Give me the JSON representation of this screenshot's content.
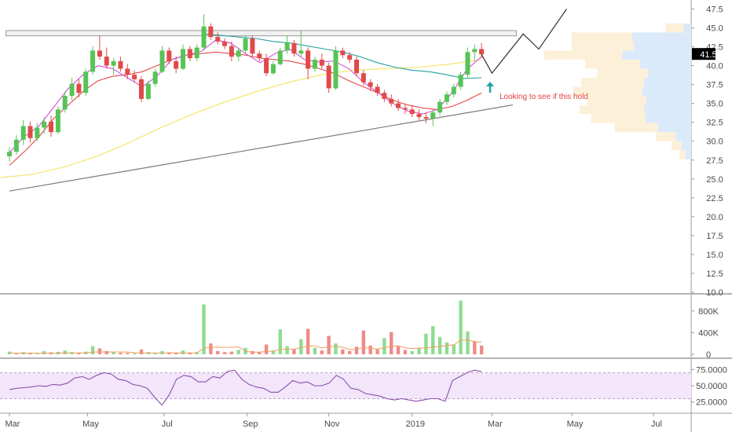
{
  "chart_data": {
    "type": "candlestick",
    "x_ticks": [
      "Mar",
      "May",
      "Jul",
      "Sep",
      "Nov",
      "2019",
      "Mar",
      "May",
      "Jul"
    ],
    "price_ticks": [
      "47.5",
      "45.0",
      "42.5",
      "40.0",
      "37.5",
      "35.0",
      "32.5",
      "30.0",
      "27.5",
      "25.0",
      "22.5",
      "20.0",
      "17.5",
      "15.0",
      "12.5",
      "10.0"
    ],
    "price_axis_range": [
      10.0,
      47.5
    ],
    "last_price_label": "41.5",
    "last_price_tag_color": "#e04a4a",
    "volume_ticks": [
      "800K",
      "400K",
      "0"
    ],
    "rsi_ticks": [
      "75.0000",
      "50.0000",
      "25.0000"
    ],
    "rsi_band": [
      30,
      70
    ],
    "annotation_text": "Looking to see if this hold",
    "colors": {
      "up": "#56c456",
      "down": "#e04a4a",
      "ma_fast": "#d84fd8",
      "ma_mid": "#e04a4a",
      "ma_teal": "#27a0a0",
      "ma_slow": "#f6e262",
      "trendline": "#7a7a7a",
      "resistance": "#9a9a9a",
      "arrow": "#27a0a0",
      "rsi_line": "#8b4fa8",
      "rsi_fill": "#f3e6fb",
      "vp_blue": "#dbeafb",
      "vp_orange": "#fdf0d9"
    },
    "resistance_level": 44.3,
    "price_series": [
      {
        "d": 0,
        "o": 28.0,
        "h": 29.2,
        "l": 27.3,
        "c": 28.6
      },
      {
        "d": 4,
        "o": 28.6,
        "h": 30.8,
        "l": 28.2,
        "c": 30.2
      },
      {
        "d": 8,
        "o": 30.2,
        "h": 32.8,
        "l": 29.5,
        "c": 32.0
      },
      {
        "d": 12,
        "o": 32.0,
        "h": 32.6,
        "l": 29.8,
        "c": 30.4
      },
      {
        "d": 16,
        "o": 30.4,
        "h": 32.4,
        "l": 30.0,
        "c": 31.8
      },
      {
        "d": 20,
        "o": 31.8,
        "h": 33.2,
        "l": 31.0,
        "c": 32.6
      },
      {
        "d": 24,
        "o": 32.6,
        "h": 33.4,
        "l": 30.6,
        "c": 31.2
      },
      {
        "d": 28,
        "o": 31.2,
        "h": 34.6,
        "l": 31.0,
        "c": 34.2
      },
      {
        "d": 32,
        "o": 34.2,
        "h": 36.6,
        "l": 33.8,
        "c": 36.0
      },
      {
        "d": 36,
        "o": 36.0,
        "h": 38.4,
        "l": 35.4,
        "c": 37.6
      },
      {
        "d": 40,
        "o": 37.6,
        "h": 38.2,
        "l": 35.8,
        "c": 36.4
      },
      {
        "d": 44,
        "o": 36.4,
        "h": 39.6,
        "l": 36.0,
        "c": 39.2
      },
      {
        "d": 48,
        "o": 39.2,
        "h": 42.6,
        "l": 38.8,
        "c": 42.0
      },
      {
        "d": 52,
        "o": 42.0,
        "h": 44.0,
        "l": 40.8,
        "c": 41.2
      },
      {
        "d": 56,
        "o": 41.2,
        "h": 42.4,
        "l": 39.6,
        "c": 40.0
      },
      {
        "d": 60,
        "o": 40.0,
        "h": 41.0,
        "l": 38.8,
        "c": 40.6
      },
      {
        "d": 64,
        "o": 40.6,
        "h": 41.2,
        "l": 39.2,
        "c": 39.6
      },
      {
        "d": 68,
        "o": 39.6,
        "h": 40.2,
        "l": 38.2,
        "c": 38.8
      },
      {
        "d": 72,
        "o": 38.8,
        "h": 39.4,
        "l": 37.8,
        "c": 38.2
      },
      {
        "d": 76,
        "o": 38.2,
        "h": 38.6,
        "l": 35.2,
        "c": 35.6
      },
      {
        "d": 80,
        "o": 35.6,
        "h": 38.0,
        "l": 35.4,
        "c": 37.6
      },
      {
        "d": 84,
        "o": 37.6,
        "h": 39.6,
        "l": 37.2,
        "c": 39.2
      },
      {
        "d": 88,
        "o": 39.2,
        "h": 42.6,
        "l": 39.0,
        "c": 42.0
      },
      {
        "d": 92,
        "o": 42.0,
        "h": 42.4,
        "l": 40.2,
        "c": 40.6
      },
      {
        "d": 96,
        "o": 40.6,
        "h": 41.2,
        "l": 39.0,
        "c": 39.6
      },
      {
        "d": 100,
        "o": 39.6,
        "h": 42.8,
        "l": 39.4,
        "c": 42.2
      },
      {
        "d": 104,
        "o": 42.2,
        "h": 42.6,
        "l": 40.6,
        "c": 41.0
      },
      {
        "d": 108,
        "o": 41.0,
        "h": 42.8,
        "l": 40.6,
        "c": 42.4
      },
      {
        "d": 112,
        "o": 42.4,
        "h": 46.8,
        "l": 42.0,
        "c": 45.2
      },
      {
        "d": 116,
        "o": 45.2,
        "h": 45.6,
        "l": 43.4,
        "c": 43.8
      },
      {
        "d": 120,
        "o": 43.8,
        "h": 44.4,
        "l": 42.8,
        "c": 43.2
      },
      {
        "d": 124,
        "o": 43.2,
        "h": 43.6,
        "l": 42.2,
        "c": 42.6
      },
      {
        "d": 128,
        "o": 42.6,
        "h": 43.2,
        "l": 40.6,
        "c": 41.2
      },
      {
        "d": 132,
        "o": 41.2,
        "h": 42.4,
        "l": 40.6,
        "c": 42.0
      },
      {
        "d": 136,
        "o": 42.0,
        "h": 44.0,
        "l": 41.6,
        "c": 43.6
      },
      {
        "d": 140,
        "o": 43.6,
        "h": 44.0,
        "l": 41.2,
        "c": 41.6
      },
      {
        "d": 144,
        "o": 41.6,
        "h": 42.0,
        "l": 40.6,
        "c": 41.0
      },
      {
        "d": 148,
        "o": 41.0,
        "h": 41.6,
        "l": 38.6,
        "c": 39.0
      },
      {
        "d": 152,
        "o": 39.0,
        "h": 40.6,
        "l": 38.8,
        "c": 40.2
      },
      {
        "d": 156,
        "o": 40.2,
        "h": 42.4,
        "l": 40.0,
        "c": 42.0
      },
      {
        "d": 160,
        "o": 42.0,
        "h": 44.0,
        "l": 41.6,
        "c": 43.0
      },
      {
        "d": 164,
        "o": 43.0,
        "h": 43.4,
        "l": 41.2,
        "c": 41.6
      },
      {
        "d": 168,
        "o": 41.6,
        "h": 44.6,
        "l": 41.2,
        "c": 42.0
      },
      {
        "d": 172,
        "o": 42.0,
        "h": 42.4,
        "l": 38.2,
        "c": 39.6
      },
      {
        "d": 176,
        "o": 39.6,
        "h": 41.2,
        "l": 39.2,
        "c": 40.8
      },
      {
        "d": 180,
        "o": 40.8,
        "h": 41.6,
        "l": 39.6,
        "c": 40.0
      },
      {
        "d": 184,
        "o": 40.0,
        "h": 40.4,
        "l": 36.4,
        "c": 37.0
      },
      {
        "d": 188,
        "o": 37.0,
        "h": 42.6,
        "l": 36.8,
        "c": 42.0
      },
      {
        "d": 192,
        "o": 42.0,
        "h": 42.4,
        "l": 41.0,
        "c": 41.4
      },
      {
        "d": 196,
        "o": 41.4,
        "h": 41.8,
        "l": 40.4,
        "c": 40.8
      },
      {
        "d": 200,
        "o": 40.8,
        "h": 41.2,
        "l": 38.6,
        "c": 39.0
      },
      {
        "d": 204,
        "o": 39.0,
        "h": 39.4,
        "l": 37.4,
        "c": 37.8
      },
      {
        "d": 208,
        "o": 37.8,
        "h": 38.2,
        "l": 36.6,
        "c": 37.2
      },
      {
        "d": 212,
        "o": 37.2,
        "h": 37.6,
        "l": 36.0,
        "c": 36.4
      },
      {
        "d": 216,
        "o": 36.4,
        "h": 36.8,
        "l": 35.2,
        "c": 35.6
      },
      {
        "d": 220,
        "o": 35.6,
        "h": 36.2,
        "l": 34.6,
        "c": 35.0
      },
      {
        "d": 224,
        "o": 35.0,
        "h": 35.6,
        "l": 34.0,
        "c": 34.4
      },
      {
        "d": 228,
        "o": 34.4,
        "h": 35.0,
        "l": 33.6,
        "c": 34.2
      },
      {
        "d": 232,
        "o": 34.2,
        "h": 34.8,
        "l": 33.2,
        "c": 33.6
      },
      {
        "d": 236,
        "o": 33.6,
        "h": 34.2,
        "l": 32.8,
        "c": 33.2
      },
      {
        "d": 240,
        "o": 33.2,
        "h": 33.8,
        "l": 32.4,
        "c": 33.0
      },
      {
        "d": 244,
        "o": 33.0,
        "h": 34.2,
        "l": 32.0,
        "c": 33.8
      },
      {
        "d": 248,
        "o": 33.8,
        "h": 35.6,
        "l": 33.4,
        "c": 35.2
      },
      {
        "d": 252,
        "o": 35.2,
        "h": 36.6,
        "l": 34.8,
        "c": 36.2
      },
      {
        "d": 256,
        "o": 36.2,
        "h": 37.6,
        "l": 35.8,
        "c": 37.2
      },
      {
        "d": 260,
        "o": 37.2,
        "h": 39.2,
        "l": 36.8,
        "c": 38.8
      },
      {
        "d": 264,
        "o": 38.8,
        "h": 42.4,
        "l": 38.4,
        "c": 41.8
      },
      {
        "d": 268,
        "o": 41.8,
        "h": 42.8,
        "l": 40.6,
        "c": 42.2
      },
      {
        "d": 272,
        "o": 42.2,
        "h": 43.0,
        "l": 41.0,
        "c": 41.5
      }
    ],
    "projection": [
      {
        "d": 272,
        "p": 41.5
      },
      {
        "d": 278,
        "p": 39.0
      },
      {
        "d": 296,
        "p": 44.2
      },
      {
        "d": 305,
        "p": 42.2
      },
      {
        "d": 321,
        "p": 47.5
      }
    ],
    "ma_fast": [
      28.5,
      30.6,
      32.0,
      34.5,
      37.0,
      38.8,
      40.0,
      39.6,
      38.4,
      37.2,
      38.6,
      40.8,
      41.4,
      41.9,
      43.4,
      43.0,
      41.6,
      40.4,
      41.6,
      42.2,
      40.8,
      40.5,
      40.6,
      39.6,
      37.8,
      36.4,
      35.0,
      34.0,
      33.6,
      34.2,
      36.4,
      39.5,
      41.2
    ],
    "ma_mid": [
      26.8,
      28.6,
      30.6,
      33.0,
      34.8,
      36.6,
      38.0,
      38.6,
      38.8,
      39.2,
      40.0,
      40.8,
      41.4,
      41.6,
      41.8,
      41.6,
      41.4,
      41.0,
      40.8,
      40.6,
      40.2,
      39.6,
      39.0,
      38.0,
      37.2,
      36.4,
      35.4,
      34.8,
      34.4,
      34.2,
      34.6,
      35.4,
      36.4
    ],
    "ma_teal": [
      44.2,
      44.0,
      43.8,
      43.6,
      43.2,
      43.0,
      42.6,
      42.2,
      41.8,
      41.2,
      40.4,
      39.8,
      39.4,
      39.2,
      38.8,
      38.3,
      38.4
    ],
    "ma_slow": [
      25.2,
      25.6,
      26.6,
      28.0,
      29.8,
      31.8,
      33.6,
      35.2,
      36.6,
      37.8,
      38.8,
      39.4,
      39.6,
      39.8,
      40.2,
      40.8
    ],
    "trendline": [
      {
        "d": 0,
        "p": 23.4
      },
      {
        "d": 290,
        "p": 34.8
      }
    ],
    "volume_profile": [
      {
        "p": 45.0,
        "buy": 8,
        "sell": 18
      },
      {
        "p": 43.8,
        "buy": 60,
        "sell": 62
      },
      {
        "p": 42.6,
        "buy": 58,
        "sell": 64
      },
      {
        "p": 41.4,
        "buy": 70,
        "sell": 80
      },
      {
        "p": 40.2,
        "buy": 52,
        "sell": 56
      },
      {
        "p": 39.0,
        "buy": 44,
        "sell": 52
      },
      {
        "p": 37.8,
        "buy": 48,
        "sell": 64
      },
      {
        "p": 36.6,
        "buy": 50,
        "sell": 70
      },
      {
        "p": 35.4,
        "buy": 46,
        "sell": 60
      },
      {
        "p": 34.2,
        "buy": 48,
        "sell": 66
      },
      {
        "p": 33.0,
        "buy": 46,
        "sell": 56
      },
      {
        "p": 31.8,
        "buy": 34,
        "sell": 44
      },
      {
        "p": 30.6,
        "buy": 16,
        "sell": 20
      },
      {
        "p": 29.4,
        "buy": 10,
        "sell": 10
      },
      {
        "p": 28.2,
        "buy": 6,
        "sell": 6
      }
    ],
    "volume": [
      {
        "d": 0,
        "v": 50,
        "u": true
      },
      {
        "d": 4,
        "v": 20,
        "u": false
      },
      {
        "d": 8,
        "v": 40,
        "u": true
      },
      {
        "d": 12,
        "v": 30,
        "u": false
      },
      {
        "d": 16,
        "v": 25,
        "u": true
      },
      {
        "d": 20,
        "v": 60,
        "u": true
      },
      {
        "d": 24,
        "v": 35,
        "u": false
      },
      {
        "d": 28,
        "v": 45,
        "u": true
      },
      {
        "d": 32,
        "v": 70,
        "u": true
      },
      {
        "d": 36,
        "v": 40,
        "u": true
      },
      {
        "d": 40,
        "v": 30,
        "u": false
      },
      {
        "d": 44,
        "v": 50,
        "u": true
      },
      {
        "d": 48,
        "v": 150,
        "u": true
      },
      {
        "d": 52,
        "v": 110,
        "u": false
      },
      {
        "d": 56,
        "v": 60,
        "u": false
      },
      {
        "d": 60,
        "v": 40,
        "u": true
      },
      {
        "d": 64,
        "v": 30,
        "u": false
      },
      {
        "d": 68,
        "v": 25,
        "u": false
      },
      {
        "d": 72,
        "v": 20,
        "u": true
      },
      {
        "d": 76,
        "v": 90,
        "u": false
      },
      {
        "d": 80,
        "v": 40,
        "u": true
      },
      {
        "d": 84,
        "v": 30,
        "u": true
      },
      {
        "d": 88,
        "v": 60,
        "u": true
      },
      {
        "d": 92,
        "v": 35,
        "u": false
      },
      {
        "d": 96,
        "v": 25,
        "u": false
      },
      {
        "d": 100,
        "v": 70,
        "u": true
      },
      {
        "d": 104,
        "v": 30,
        "u": false
      },
      {
        "d": 108,
        "v": 40,
        "u": true
      },
      {
        "d": 112,
        "v": 920,
        "u": true
      },
      {
        "d": 116,
        "v": 200,
        "u": false
      },
      {
        "d": 120,
        "v": 60,
        "u": false
      },
      {
        "d": 124,
        "v": 40,
        "u": false
      },
      {
        "d": 128,
        "v": 50,
        "u": false
      },
      {
        "d": 132,
        "v": 80,
        "u": true
      },
      {
        "d": 136,
        "v": 120,
        "u": true
      },
      {
        "d": 140,
        "v": 60,
        "u": false
      },
      {
        "d": 144,
        "v": 40,
        "u": false
      },
      {
        "d": 148,
        "v": 180,
        "u": false
      },
      {
        "d": 152,
        "v": 70,
        "u": true
      },
      {
        "d": 156,
        "v": 460,
        "u": true
      },
      {
        "d": 160,
        "v": 150,
        "u": true
      },
      {
        "d": 164,
        "v": 90,
        "u": false
      },
      {
        "d": 168,
        "v": 280,
        "u": true
      },
      {
        "d": 172,
        "v": 470,
        "u": false
      },
      {
        "d": 176,
        "v": 120,
        "u": true
      },
      {
        "d": 180,
        "v": 70,
        "u": false
      },
      {
        "d": 184,
        "v": 340,
        "u": false
      },
      {
        "d": 188,
        "v": 200,
        "u": true
      },
      {
        "d": 192,
        "v": 90,
        "u": false
      },
      {
        "d": 196,
        "v": 60,
        "u": false
      },
      {
        "d": 200,
        "v": 140,
        "u": false
      },
      {
        "d": 204,
        "v": 440,
        "u": false
      },
      {
        "d": 208,
        "v": 160,
        "u": false
      },
      {
        "d": 212,
        "v": 90,
        "u": false
      },
      {
        "d": 216,
        "v": 300,
        "u": true
      },
      {
        "d": 220,
        "v": 410,
        "u": false
      },
      {
        "d": 224,
        "v": 150,
        "u": false
      },
      {
        "d": 228,
        "v": 80,
        "u": false
      },
      {
        "d": 232,
        "v": 60,
        "u": true
      },
      {
        "d": 236,
        "v": 120,
        "u": true
      },
      {
        "d": 240,
        "v": 380,
        "u": true
      },
      {
        "d": 244,
        "v": 520,
        "u": true
      },
      {
        "d": 248,
        "v": 320,
        "u": true
      },
      {
        "d": 252,
        "v": 220,
        "u": true
      },
      {
        "d": 256,
        "v": 180,
        "u": true
      },
      {
        "d": 260,
        "v": 990,
        "u": true
      },
      {
        "d": 264,
        "v": 420,
        "u": true
      },
      {
        "d": 268,
        "v": 240,
        "u": false
      },
      {
        "d": 272,
        "v": 160,
        "u": false
      }
    ],
    "volume_max": 1000,
    "rsi": [
      44,
      46,
      47,
      48,
      50,
      49,
      52,
      51,
      54,
      62,
      64,
      60,
      66,
      70,
      68,
      60,
      58,
      52,
      50,
      46,
      32,
      20,
      36,
      60,
      66,
      64,
      56,
      56,
      64,
      62,
      72,
      74,
      60,
      52,
      48,
      46,
      40,
      40,
      48,
      58,
      54,
      56,
      50,
      50,
      54,
      66,
      60,
      46,
      44,
      38,
      36,
      34,
      30,
      28,
      30,
      28,
      26,
      28,
      30,
      30,
      26,
      58,
      64,
      70,
      74,
      72
    ]
  }
}
